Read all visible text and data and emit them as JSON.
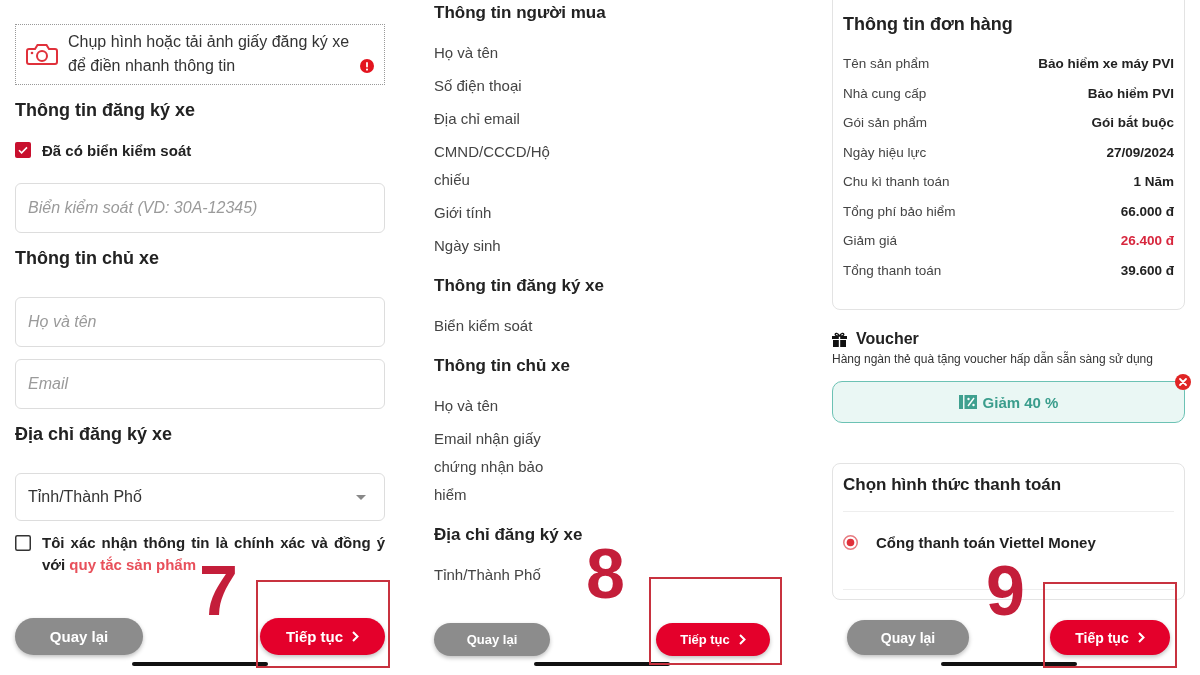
{
  "screens": [
    {
      "kind": "vehicle_form",
      "upload_prompt": "Chụp hình hoặc tải ảnh giấy đăng ký xe để điền nhanh thông tin",
      "sections": [
        {
          "title": "Thông tin đăng ký xe",
          "items": [
            {
              "kind": "checkbox",
              "label": "Đã có biển kiểm soát",
              "checked": true
            },
            {
              "kind": "input",
              "placeholder": "Biển kiểm soát (VD: 30A-12345)"
            }
          ]
        },
        {
          "title": "Thông tin chủ xe",
          "items": [
            {
              "kind": "input",
              "placeholder": "Họ và tên"
            },
            {
              "kind": "input",
              "placeholder": "Email"
            }
          ]
        },
        {
          "title": "Địa chỉ đăng ký xe",
          "items": [
            {
              "kind": "select",
              "value": "Tỉnh/Thành Phố"
            }
          ]
        }
      ],
      "agreement": {
        "checked": false,
        "text": "Tôi xác nhận thông tin là chính xác và đồng ý với",
        "link": "quy tắc sản phẩm"
      },
      "step_marker": "7",
      "buttons": [
        {
          "kind": "secondary",
          "label": "Quay lại",
          "highlighted": false
        },
        {
          "kind": "primary",
          "label": "Tiếp tục",
          "highlighted": true
        }
      ]
    },
    {
      "kind": "review",
      "sections": [
        {
          "title": "Thông tin người mua",
          "fields": [
            "Họ và tên",
            "Số điện thoại",
            "Địa chỉ email",
            "CMND/CCCD/Hộ chiếu",
            "Giới tính",
            "Ngày sinh"
          ]
        },
        {
          "title": "Thông tin đăng ký xe",
          "fields": [
            "Biển kiểm soát"
          ]
        },
        {
          "title": "Thông tin chủ xe",
          "fields": [
            "Họ và tên",
            "Email nhận giấy chứng nhận bảo hiểm"
          ]
        },
        {
          "title": "Địa chỉ đăng ký xe",
          "fields": [
            "Tỉnh/Thành Phố"
          ]
        }
      ],
      "step_marker": "8",
      "buttons": [
        {
          "kind": "secondary",
          "label": "Quay lại",
          "highlighted": false
        },
        {
          "kind": "primary",
          "label": "Tiếp tục",
          "highlighted": true
        }
      ]
    },
    {
      "kind": "checkout",
      "order": {
        "title": "Thông tin đơn hàng",
        "rows": [
          {
            "kind": "plain",
            "label": "Tên sản phẩm",
            "value": "Bảo hiểm xe máy PVI"
          },
          {
            "kind": "plain",
            "label": "Nhà cung cấp",
            "value": "Bảo hiểm PVI"
          },
          {
            "kind": "plain",
            "label": "Gói sản phẩm",
            "value": "Gói bắt buộc"
          },
          {
            "kind": "plain",
            "label": "Ngày hiệu lực",
            "value": "27/09/2024"
          },
          {
            "kind": "plain",
            "label": "Chu kì thanh toán",
            "value": "1 Năm"
          },
          {
            "kind": "plain",
            "label": "Tổng phí bảo hiểm",
            "value": "66.000 đ"
          },
          {
            "kind": "discount",
            "label": "Giảm giá",
            "value": "26.400 đ"
          },
          {
            "kind": "plain",
            "label": "Tổng thanh toán",
            "value": "39.600 đ"
          }
        ]
      },
      "voucher": {
        "title": "Voucher",
        "subtitle": "Hàng ngàn thẻ quà tặng voucher hấp dẫn sẵn sàng sử dụng",
        "applied": "Giảm 40 %"
      },
      "payment": {
        "title": "Chọn hình thức thanh toán",
        "options": [
          {
            "label": "Cổng thanh toán Viettel Money",
            "selected": true
          }
        ]
      },
      "step_marker": "9",
      "buttons": [
        {
          "kind": "secondary",
          "label": "Quay lại",
          "highlighted": false
        },
        {
          "kind": "primary",
          "label": "Tiếp tục",
          "highlighted": true
        }
      ]
    }
  ]
}
